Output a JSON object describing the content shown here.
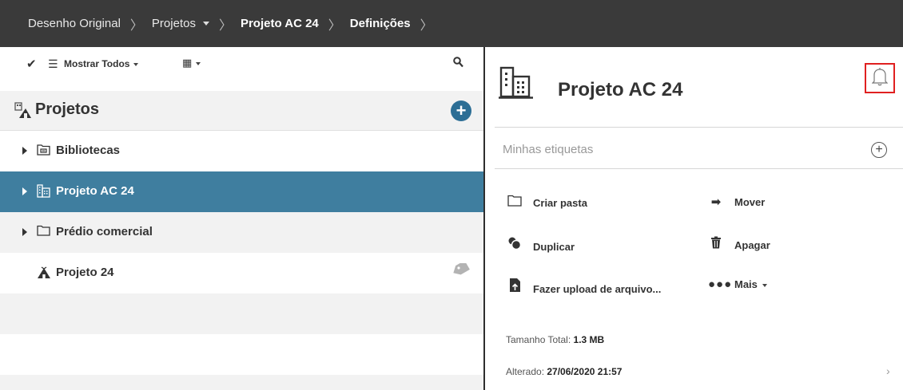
{
  "breadcrumb": {
    "items": [
      "Desenho Original",
      "Projetos",
      "Projeto AC 24",
      "Definições"
    ]
  },
  "toolbar": {
    "show_label": "Mostrar Todos"
  },
  "projects_header": {
    "title": "Projetos",
    "add_label": "+"
  },
  "tree": {
    "items": [
      {
        "label": "Bibliotecas"
      },
      {
        "label": "Projeto AC 24"
      },
      {
        "label": "Prédio comercial"
      },
      {
        "label": "Projeto 24"
      }
    ]
  },
  "detail": {
    "title": "Projeto AC 24",
    "tags_placeholder": "Minhas etiquetas",
    "actions": {
      "create_folder": "Criar pasta",
      "move": "Mover",
      "duplicate": "Duplicar",
      "delete": "Apagar",
      "upload": "Fazer upload de arquivo...",
      "more": "Mais"
    },
    "size_label": "Tamanho Total:",
    "size_value": "1.3 MB",
    "changed_label": "Alterado:",
    "changed_value": "27/06/2020 21:57"
  },
  "colors": {
    "topbar": "#3a3a3a",
    "selected_row": "#3f7e9f",
    "add_button": "#2c6e95",
    "highlight_box": "#e02020"
  }
}
